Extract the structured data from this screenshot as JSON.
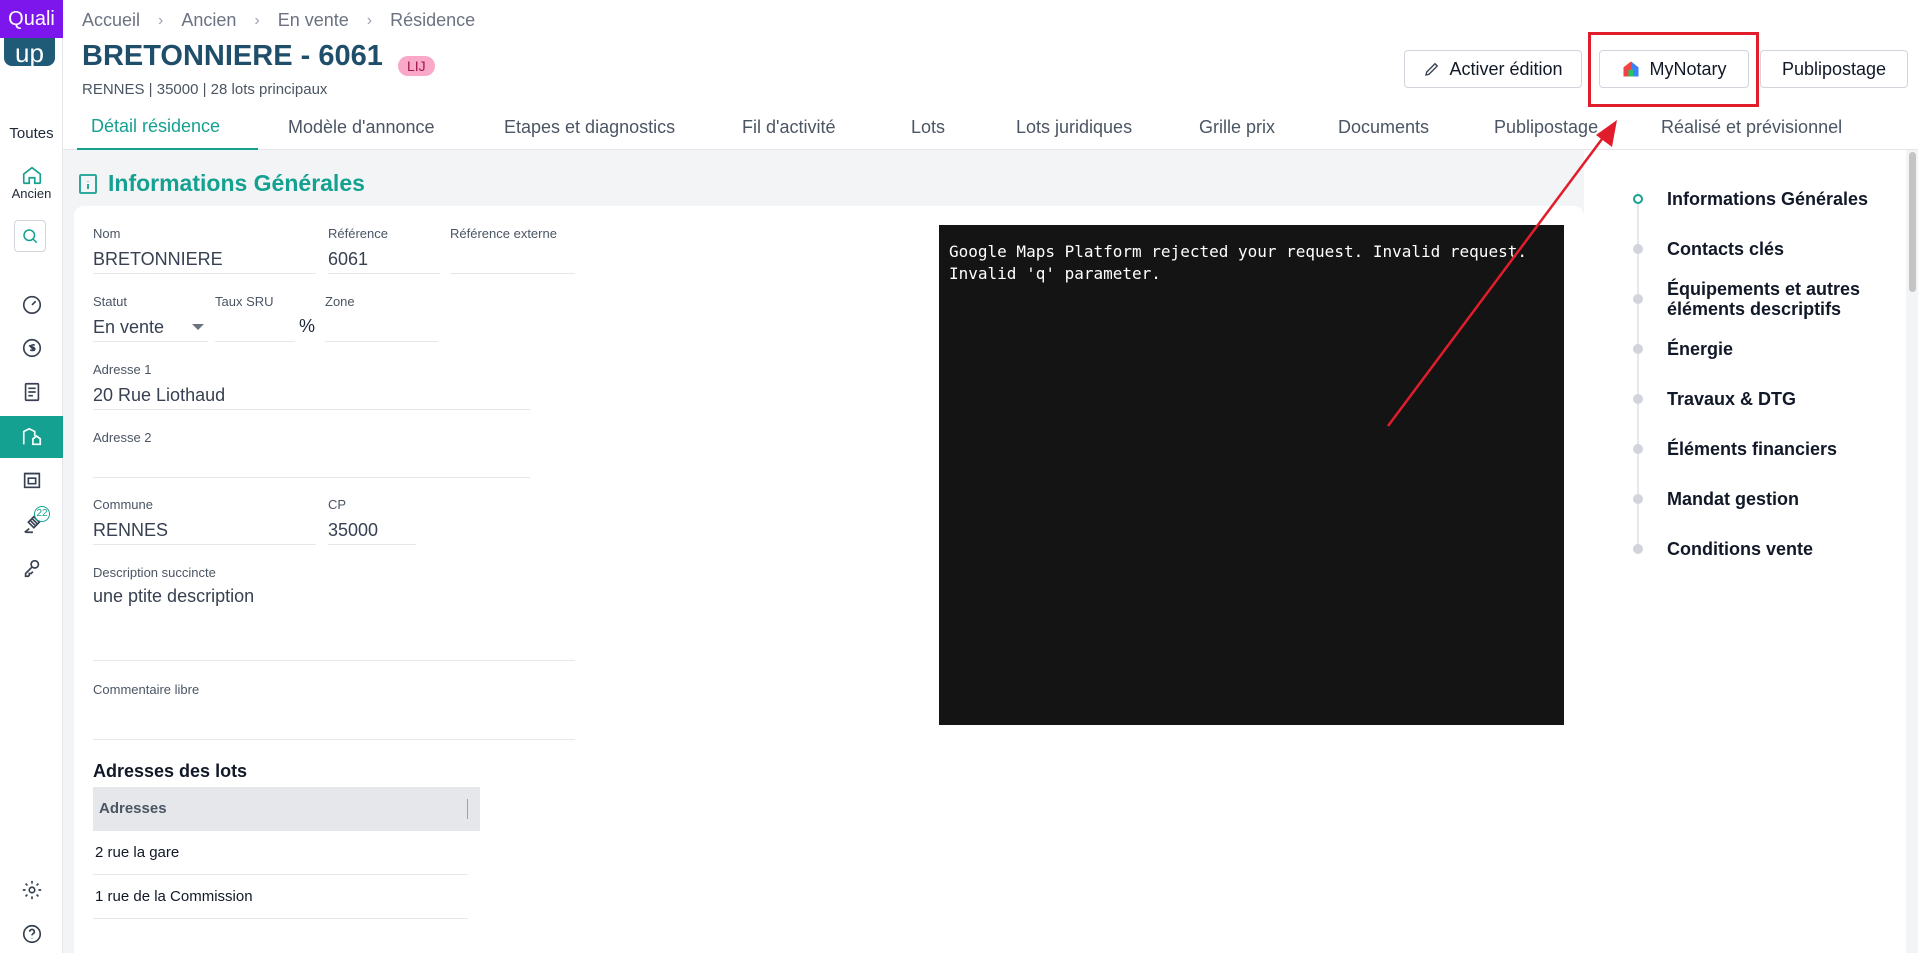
{
  "app": {
    "logo_badge": "Quali",
    "logo_sub": "up"
  },
  "sidebar": {
    "all_label": "Toutes",
    "ancien_label": "Ancien",
    "notification_count": "22"
  },
  "breadcrumb": [
    "Accueil",
    "Ancien",
    "En vente",
    "Résidence"
  ],
  "header": {
    "title": "BRETONNIERE - 6061",
    "badge": "LIJ",
    "subtitle": "RENNES | 35000 | 28 lots principaux",
    "edit_label": "Activer édition",
    "mynotary_label": "MyNotary",
    "publipostage_label": "Publipostage"
  },
  "tabs": [
    {
      "label": "Détail résidence",
      "active": true
    },
    {
      "label": "Modèle d'annonce"
    },
    {
      "label": "Etapes et diagnostics"
    },
    {
      "label": "Fil d'activité"
    },
    {
      "label": "Lots"
    },
    {
      "label": "Lots juridiques"
    },
    {
      "label": "Grille prix"
    },
    {
      "label": "Documents"
    },
    {
      "label": "Publipostage"
    },
    {
      "label": "Réalisé et prévisionnel"
    }
  ],
  "section": {
    "title": "Informations Générales"
  },
  "fields": {
    "nom": {
      "label": "Nom",
      "value": "BRETONNIERE"
    },
    "reference": {
      "label": "Référence",
      "value": "6061"
    },
    "reference_externe": {
      "label": "Référence externe",
      "value": ""
    },
    "statut": {
      "label": "Statut",
      "value": "En vente"
    },
    "taux_sru": {
      "label": "Taux SRU",
      "value": "",
      "unit": "%"
    },
    "zone": {
      "label": "Zone",
      "value": ""
    },
    "adresse1": {
      "label": "Adresse 1",
      "value": "20 Rue Liothaud"
    },
    "adresse2": {
      "label": "Adresse 2",
      "value": ""
    },
    "commune": {
      "label": "Commune",
      "value": "RENNES"
    },
    "cp": {
      "label": "CP",
      "value": "35000"
    },
    "description": {
      "label": "Description succincte",
      "value": "une ptite description"
    },
    "commentaire": {
      "label": "Commentaire libre",
      "value": ""
    }
  },
  "map": {
    "error_text": "Google Maps Platform rejected your request. Invalid request.\nInvalid 'q' parameter."
  },
  "lots": {
    "title": "Adresses des lots",
    "column": "Adresses",
    "rows": [
      "2 rue la gare",
      "1 rue de la Commission"
    ]
  },
  "right_nav": [
    "Informations Générales",
    "Contacts clés",
    "Équipements et autres éléments descriptifs",
    "Énergie",
    "Travaux & DTG",
    "Éléments financiers",
    "Mandat gestion",
    "Conditions vente"
  ],
  "colors": {
    "accent": "#15a191",
    "title": "#1f4e6b",
    "highlight": "#e11d2c",
    "brand": "#7c16ec"
  }
}
